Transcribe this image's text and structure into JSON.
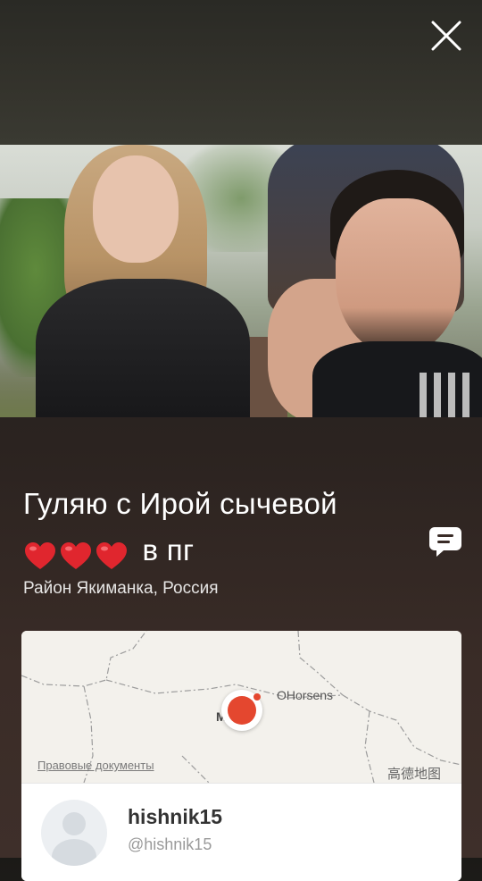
{
  "post": {
    "caption_line1": "Гуляю с Ирой сычевой",
    "caption_hearts": [
      "heart",
      "heart",
      "heart"
    ],
    "caption_line2_text": "в пг",
    "location": "Район Якиманка, Россия"
  },
  "map": {
    "city_label_1": "OHorsens",
    "city_label_2": "Mva",
    "legal_link": "Правовые документы",
    "provider": "高德地图",
    "marker_color": "#e4472f"
  },
  "user": {
    "username": "hishnik15",
    "handle": "@hishnik15"
  },
  "icons": {
    "close": "close-icon",
    "comment": "comment-icon",
    "heart": "heart-icon",
    "avatar": "user-placeholder-icon"
  }
}
